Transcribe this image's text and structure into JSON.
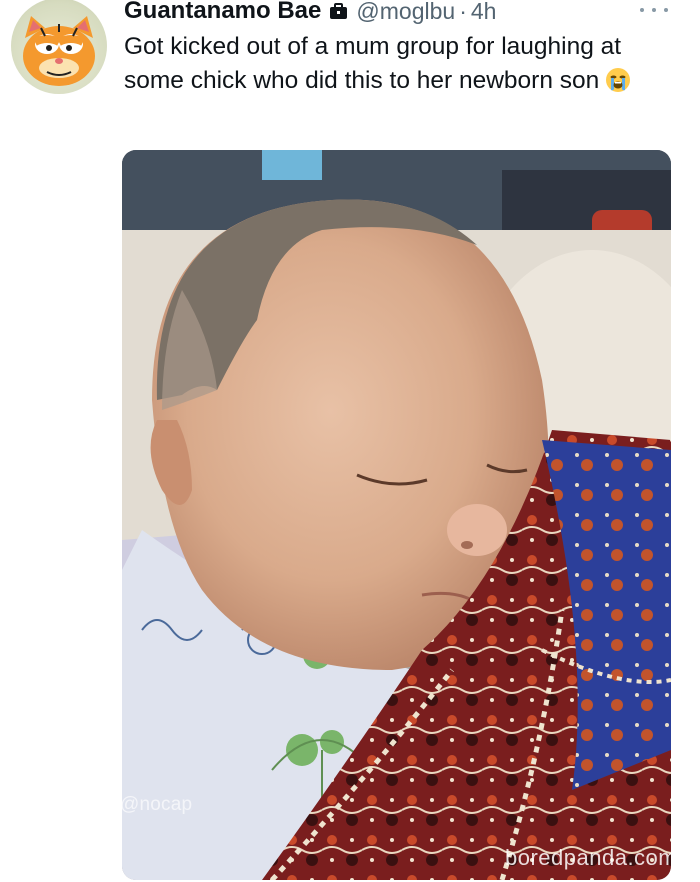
{
  "tweet": {
    "display_name": "Guantanamo Bae",
    "verified_badge_icon": "briefcase-badge-icon",
    "handle": "@moglbu",
    "separator": "·",
    "time": "4h",
    "more_icon": "more-options-icon",
    "text": "Got kicked out of a mum group for laughing at some chick who did this to her newborn son",
    "emoji_icon": "loudly-crying-face-icon",
    "avatar_icon": "garfield-avatar-icon"
  },
  "media": {
    "image_icon": "baby-photo",
    "watermark_nocap": "@nocap",
    "watermark_site": "boredpanda.com"
  }
}
